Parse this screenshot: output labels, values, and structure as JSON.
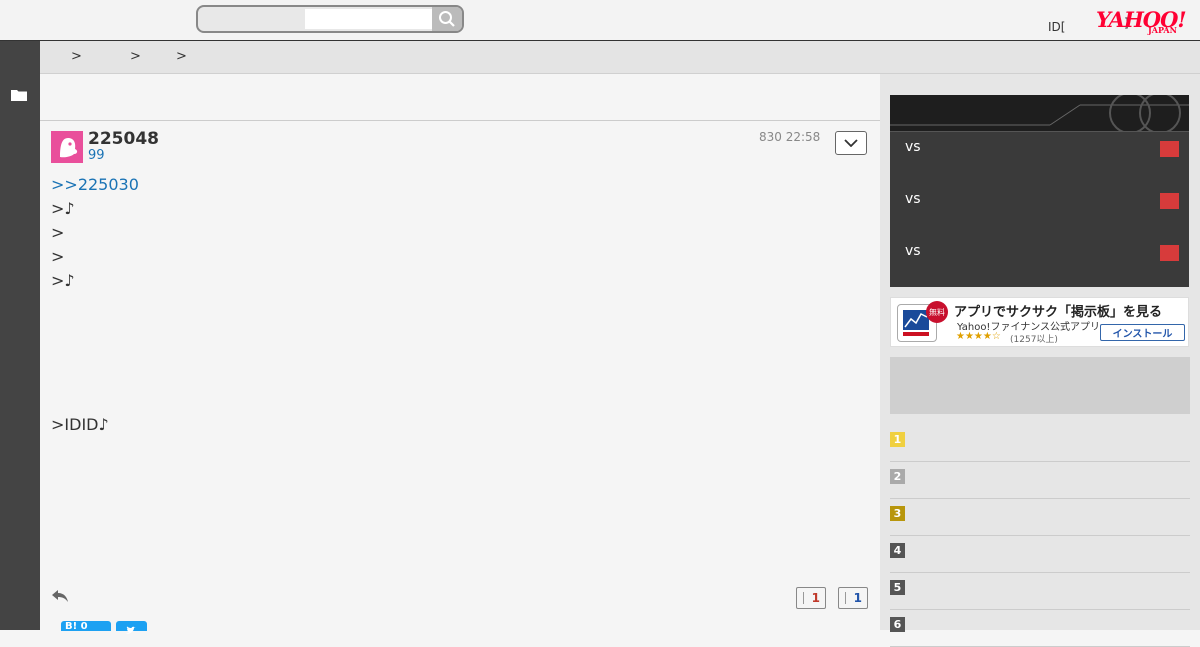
{
  "header": {
    "search_placeholder": "",
    "id_text": "ID[",
    "id_text_tail": "]",
    "logo_main": "YAHOO!",
    "logo_sub": "JAPAN"
  },
  "breadcrumb": [
    ">",
    ">",
    ">"
  ],
  "post": {
    "number": "225048",
    "sub": "99",
    "date": "830 22:58",
    "lines": [
      ">>225030",
      ">♪",
      ">",
      ">",
      ">♪",
      ">IDID♪"
    ],
    "vote_up": "1",
    "vote_down": "1",
    "share_label": "B! 0"
  },
  "scoreboard": {
    "rows": [
      {
        "vs": "vs"
      },
      {
        "vs": "vs"
      },
      {
        "vs": "vs"
      }
    ]
  },
  "app_ad": {
    "badge": "無料",
    "title": "アプリでサクサク「掲示板」を見る",
    "subtitle": "Yahoo!ファイナンス公式アプリ",
    "stars": "★★★★☆",
    "rating": "(1257以上)",
    "install": "インストール"
  },
  "ranking": [
    {
      "num": "1",
      "color": "#f0d040"
    },
    {
      "num": "2",
      "color": "#aaaaaa"
    },
    {
      "num": "3",
      "color": "#b8960c"
    },
    {
      "num": "4",
      "color": "#555555"
    },
    {
      "num": "5",
      "color": "#555555"
    },
    {
      "num": "6",
      "color": "#555555"
    }
  ],
  "colors": {
    "accent": "#ff0033",
    "link": "#1a73b5",
    "avatar": "#e94f9b",
    "vote_up": "#c0392b",
    "vote_down": "#2255aa"
  }
}
